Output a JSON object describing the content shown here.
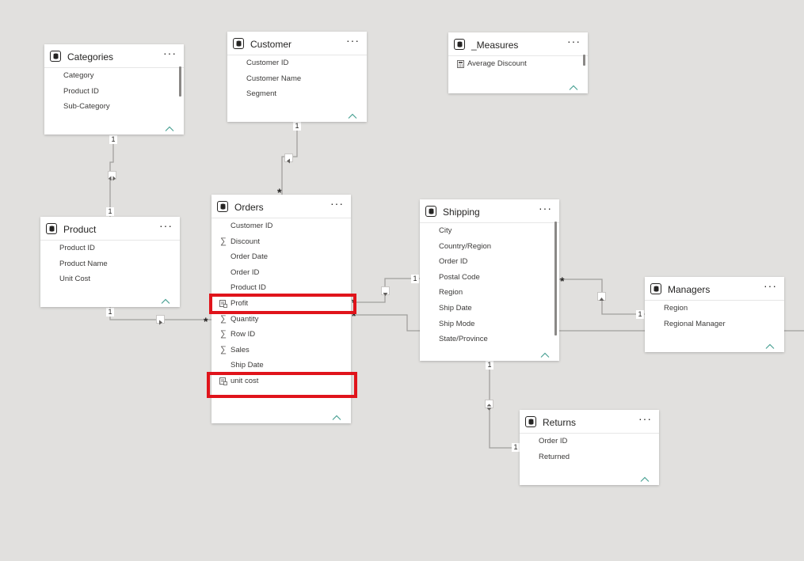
{
  "tables": {
    "categories": {
      "title": "Categories",
      "fields": [
        {
          "label": "Category",
          "icon": ""
        },
        {
          "label": "Product ID",
          "icon": ""
        },
        {
          "label": "Sub-Category",
          "icon": ""
        }
      ]
    },
    "customer": {
      "title": "Customer",
      "fields": [
        {
          "label": "Customer ID",
          "icon": ""
        },
        {
          "label": "Customer Name",
          "icon": ""
        },
        {
          "label": "Segment",
          "icon": ""
        }
      ]
    },
    "measures": {
      "title": "_Measures",
      "fields": [
        {
          "label": "Average Discount",
          "icon": "calculator-icon"
        }
      ]
    },
    "product": {
      "title": "Product",
      "fields": [
        {
          "label": "Product ID",
          "icon": ""
        },
        {
          "label": "Product Name",
          "icon": ""
        },
        {
          "label": "Unit Cost",
          "icon": ""
        }
      ]
    },
    "orders": {
      "title": "Orders",
      "fields": [
        {
          "label": "Customer ID",
          "icon": ""
        },
        {
          "label": "Discount",
          "icon": "sigma-icon"
        },
        {
          "label": "Order Date",
          "icon": ""
        },
        {
          "label": "Order ID",
          "icon": ""
        },
        {
          "label": "Product ID",
          "icon": ""
        },
        {
          "label": "Profit",
          "icon": "calculated-column-icon"
        },
        {
          "label": "Quantity",
          "icon": "sigma-icon"
        },
        {
          "label": "Row ID",
          "icon": "sigma-icon"
        },
        {
          "label": "Sales",
          "icon": "sigma-icon"
        },
        {
          "label": "Ship Date",
          "icon": ""
        },
        {
          "label": "unit cost",
          "icon": "calculated-column-icon"
        }
      ]
    },
    "shipping": {
      "title": "Shipping",
      "fields": [
        {
          "label": "City",
          "icon": ""
        },
        {
          "label": "Country/Region",
          "icon": ""
        },
        {
          "label": "Order ID",
          "icon": ""
        },
        {
          "label": "Postal Code",
          "icon": ""
        },
        {
          "label": "Region",
          "icon": ""
        },
        {
          "label": "Ship Date",
          "icon": ""
        },
        {
          "label": "Ship Mode",
          "icon": ""
        },
        {
          "label": "State/Province",
          "icon": ""
        }
      ]
    },
    "managers": {
      "title": "Managers",
      "fields": [
        {
          "label": "Region",
          "icon": ""
        },
        {
          "label": "Regional Manager",
          "icon": ""
        }
      ]
    },
    "returns": {
      "title": "Returns",
      "fields": [
        {
          "label": "Order ID",
          "icon": ""
        },
        {
          "label": "Returned",
          "icon": ""
        }
      ]
    }
  },
  "cardinality": {
    "one": "1",
    "many": "*"
  },
  "ui": {
    "more_label": "···"
  },
  "colors": {
    "highlight": "#e0141b",
    "line": "#a19f9d",
    "chevron": "#4da396",
    "canvas": "#e1e0de"
  }
}
